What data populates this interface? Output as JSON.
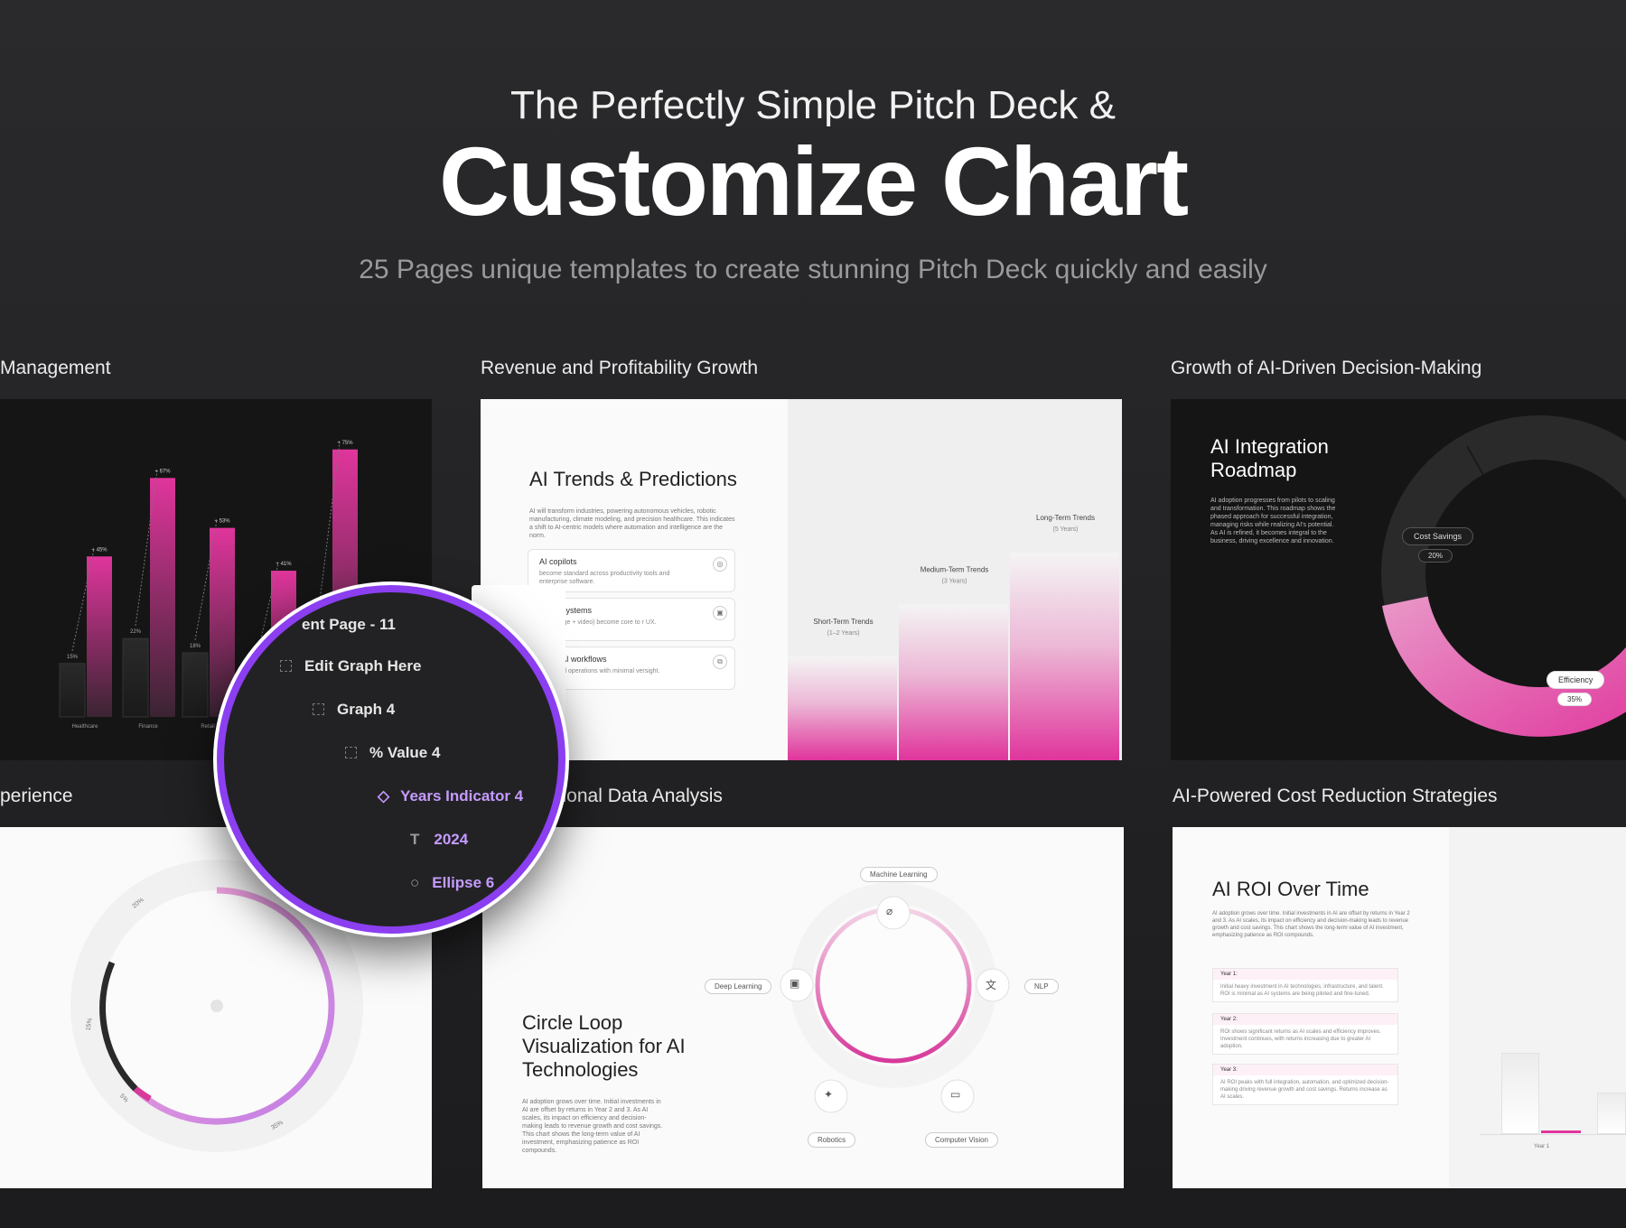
{
  "header": {
    "subtitle": "The Perfectly Simple Pitch Deck &",
    "title": "Customize Chart",
    "description": "25 Pages unique templates to create stunning Pitch Deck quickly and easily"
  },
  "cards": {
    "c1": {
      "caption": "Management",
      "chart_data": {
        "type": "bar",
        "categories": [
          "Healthcare",
          "Finance",
          "Retail",
          "",
          ""
        ],
        "series": [
          {
            "values": [
              15,
              22,
              18,
              13,
              25
            ]
          },
          {
            "values": [
              45,
              67,
              53,
              41,
              75
            ]
          }
        ],
        "data_labels_low": [
          "15%",
          "22%",
          "18%",
          "",
          ""
        ],
        "data_labels_high": [
          "+ 45%",
          "+ 67%",
          "+ 53%",
          "+ 41%",
          "+ 75%"
        ],
        "ylim": [
          0,
          80
        ]
      }
    },
    "c2": {
      "caption": "Revenue and Profitability Growth",
      "title": "AI Trends & Predictions",
      "desc": "AI will transform industries, powering autonomous vehicles, robotic manufacturing, climate modeling, and precision healthcare. This indicates a shift to AI-centric models where automation and intelligence are the norm.",
      "rows": [
        {
          "title": "AI copilots",
          "desc": "become standard across productivity tools and enterprise software."
        },
        {
          "title": "dal AI systems",
          "desc": "ce + image + video) become core to r UX."
        },
        {
          "title": "mous AI workflows",
          "desc": "nd-to-end operations with minimal versight."
        }
      ],
      "chart_data": {
        "type": "bar",
        "categories": [
          "Short-Term Trends",
          "Medium-Term Trends",
          "Long-Term Trends"
        ],
        "sublabels": [
          "(1–2 Years)",
          "(3 Years)",
          "(5 Years)"
        ],
        "values": [
          1,
          1.5,
          2
        ],
        "accent": "#e0359c"
      }
    },
    "c3": {
      "caption": "Growth of AI-Driven Decision-Making",
      "title": "AI Integration Roadmap",
      "desc": "AI adoption progresses from pilots to scaling and transformation. This roadmap shows the phased approach for successful integration, managing risks while realizing AI's potential. As AI is refined, it becomes integral to the business, driving excellence and innovation.",
      "chart_data": {
        "type": "pie",
        "labels": [
          "Cost Savings",
          "Efficiency"
        ],
        "values": [
          20,
          35
        ],
        "value_labels": [
          "20%",
          "35%"
        ]
      }
    },
    "c4": {
      "caption": "perience",
      "chart_data": {
        "type": "pie",
        "value_labels": [
          "20%",
          "15%",
          "5%",
          "35%"
        ],
        "values": [
          20,
          15,
          5,
          35
        ]
      }
    },
    "c5": {
      "caption": "itional Data Analysis",
      "title": "Circle Loop Visualization for AI Technologies",
      "desc": "AI adoption grows over time. Initial investments in AI are offset by returns in Year 2 and 3. As AI scales, its impact on efficiency and decision-making leads to revenue growth and cost savings. This chart shows the long-term value of AI investment, emphasizing patience as ROI compounds.",
      "nodes": [
        "Machine Learning",
        "NLP",
        "Computer Vision",
        "Robotics",
        "Deep Learning"
      ]
    },
    "c6": {
      "caption": "AI-Powered Cost Reduction Strategies",
      "title": "AI ROI Over Time",
      "desc": "AI adoption grows over time. Initial investments in AI are offset by returns in Year 2 and 3. As AI scales, its impact on efficiency and decision-making leads to revenue growth and cost savings. This chart shows the long-term value of AI investment, emphasizing patience as ROI compounds.",
      "rows": [
        {
          "h": "Year 1:",
          "b": "Initial heavy investment in AI technologies, infrastructure, and talent. ROI is minimal as AI systems are being piloted and fine-tuned."
        },
        {
          "h": "Year 2:",
          "b": "ROI shows significant returns as AI scales and efficiency improves. Investment continues, with returns increasing due to greater AI adoption."
        },
        {
          "h": "Year 3:",
          "b": "AI ROI peaks with full integration, automation, and optimized decision-making driving revenue growth and cost savings. Returns increase as AI scales."
        }
      ],
      "axis_label": "Year 1"
    }
  },
  "layers_panel": {
    "title": "ent Page - 11",
    "items": [
      "Edit Graph Here",
      "Graph 4",
      "% Value 4",
      "Years Indicator 4",
      "2024",
      "Ellipse 6"
    ],
    "accent": "#8b3ff0",
    "highlight": "#c59bff"
  }
}
